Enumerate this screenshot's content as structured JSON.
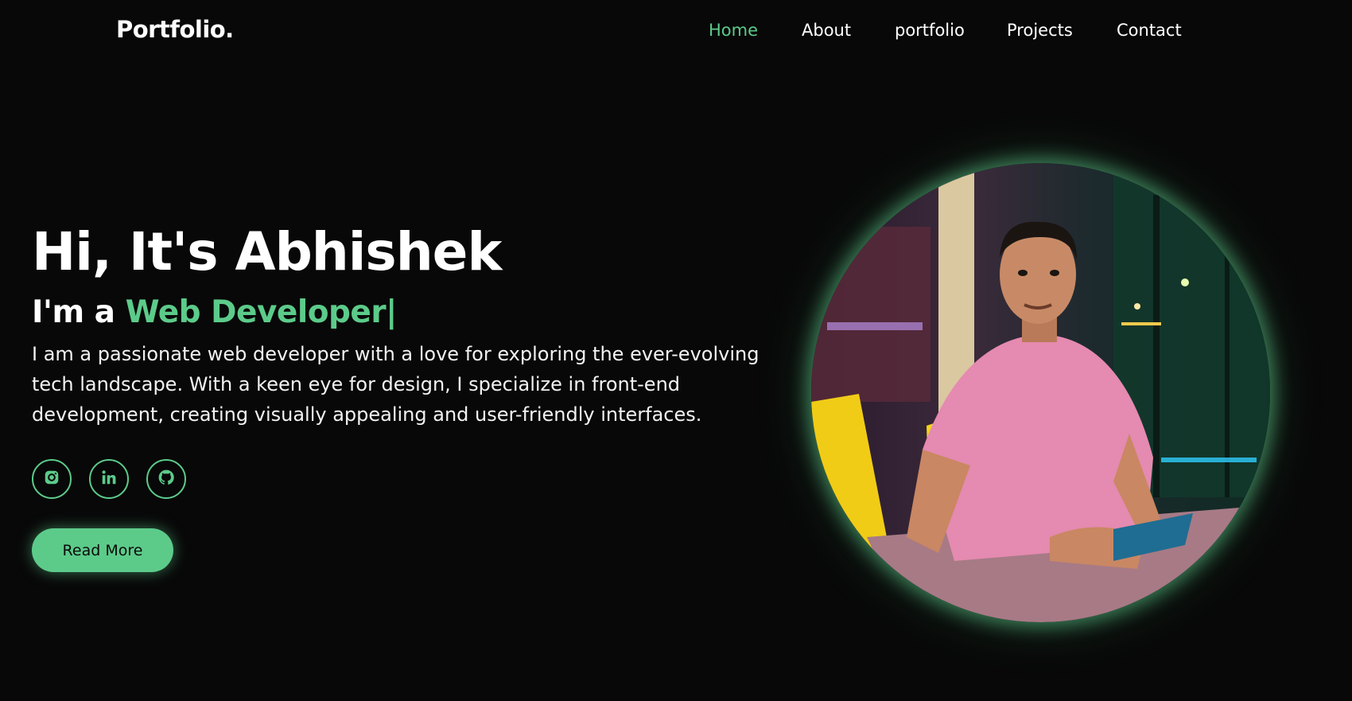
{
  "header": {
    "logo": "Portfolio.",
    "nav": [
      {
        "label": "Home",
        "active": true
      },
      {
        "label": "About",
        "active": false
      },
      {
        "label": "portfolio",
        "active": false
      },
      {
        "label": "Projects",
        "active": false
      },
      {
        "label": "Contact",
        "active": false
      }
    ]
  },
  "hero": {
    "headline": "Hi, It's Abhishek",
    "subline_prefix": "I'm a ",
    "role": "Web Developer",
    "cursor": "|",
    "description": "I am a passionate web developer with a love for exploring the ever-evolving tech landscape. With a keen eye for design, I specialize in front-end development, creating visually appealing and user-friendly interfaces.",
    "socials": [
      {
        "icon": "instagram-icon"
      },
      {
        "icon": "linkedin-icon"
      },
      {
        "icon": "github-icon"
      }
    ],
    "cta_label": "Read More"
  },
  "theme": {
    "accent": "#5ccb8a",
    "background": "#080808"
  }
}
